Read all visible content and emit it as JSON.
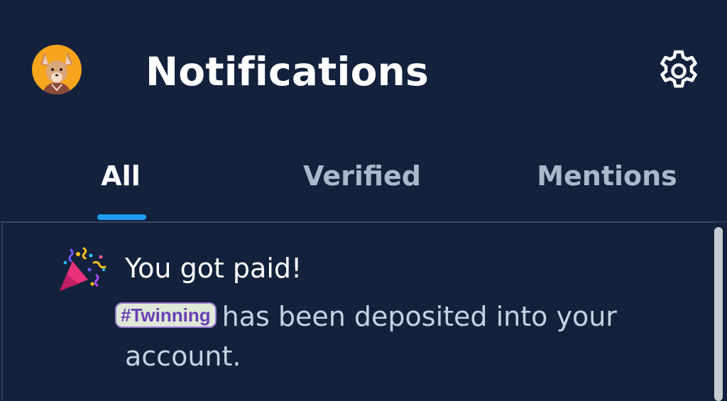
{
  "header": {
    "title": "Notifications",
    "avatar_icon": "fox-avatar-icon",
    "settings_icon": "gear-icon"
  },
  "tabs": [
    {
      "label": "All",
      "active": true
    },
    {
      "label": "Verified",
      "active": false
    },
    {
      "label": "Mentions",
      "active": false
    }
  ],
  "notification": {
    "icon": "party-popper-icon",
    "title": "You got paid!",
    "hashtag": "#Twinning",
    "body": "has been deposited into your account."
  },
  "colors": {
    "background": "#13213c",
    "accent": "#1d9bf0",
    "text_primary": "#ffffff",
    "text_secondary": "#c4d2e3"
  }
}
